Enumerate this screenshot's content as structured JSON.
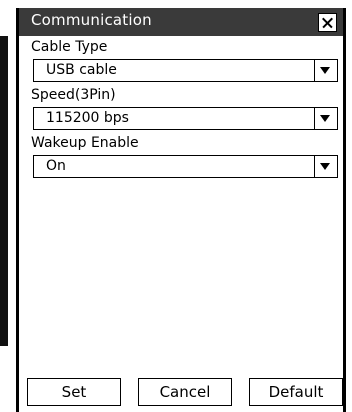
{
  "dialog": {
    "title": "Communication",
    "fields": [
      {
        "label": "Cable Type",
        "value": "USB cable"
      },
      {
        "label": "Speed(3Pin)",
        "value": "115200 bps"
      },
      {
        "label": "Wakeup Enable",
        "value": "On"
      }
    ],
    "buttons": {
      "set": "Set",
      "cancel": "Cancel",
      "default": "Default"
    }
  },
  "icons": {
    "close": "close-icon",
    "dropdown": "chevron-down-icon"
  }
}
